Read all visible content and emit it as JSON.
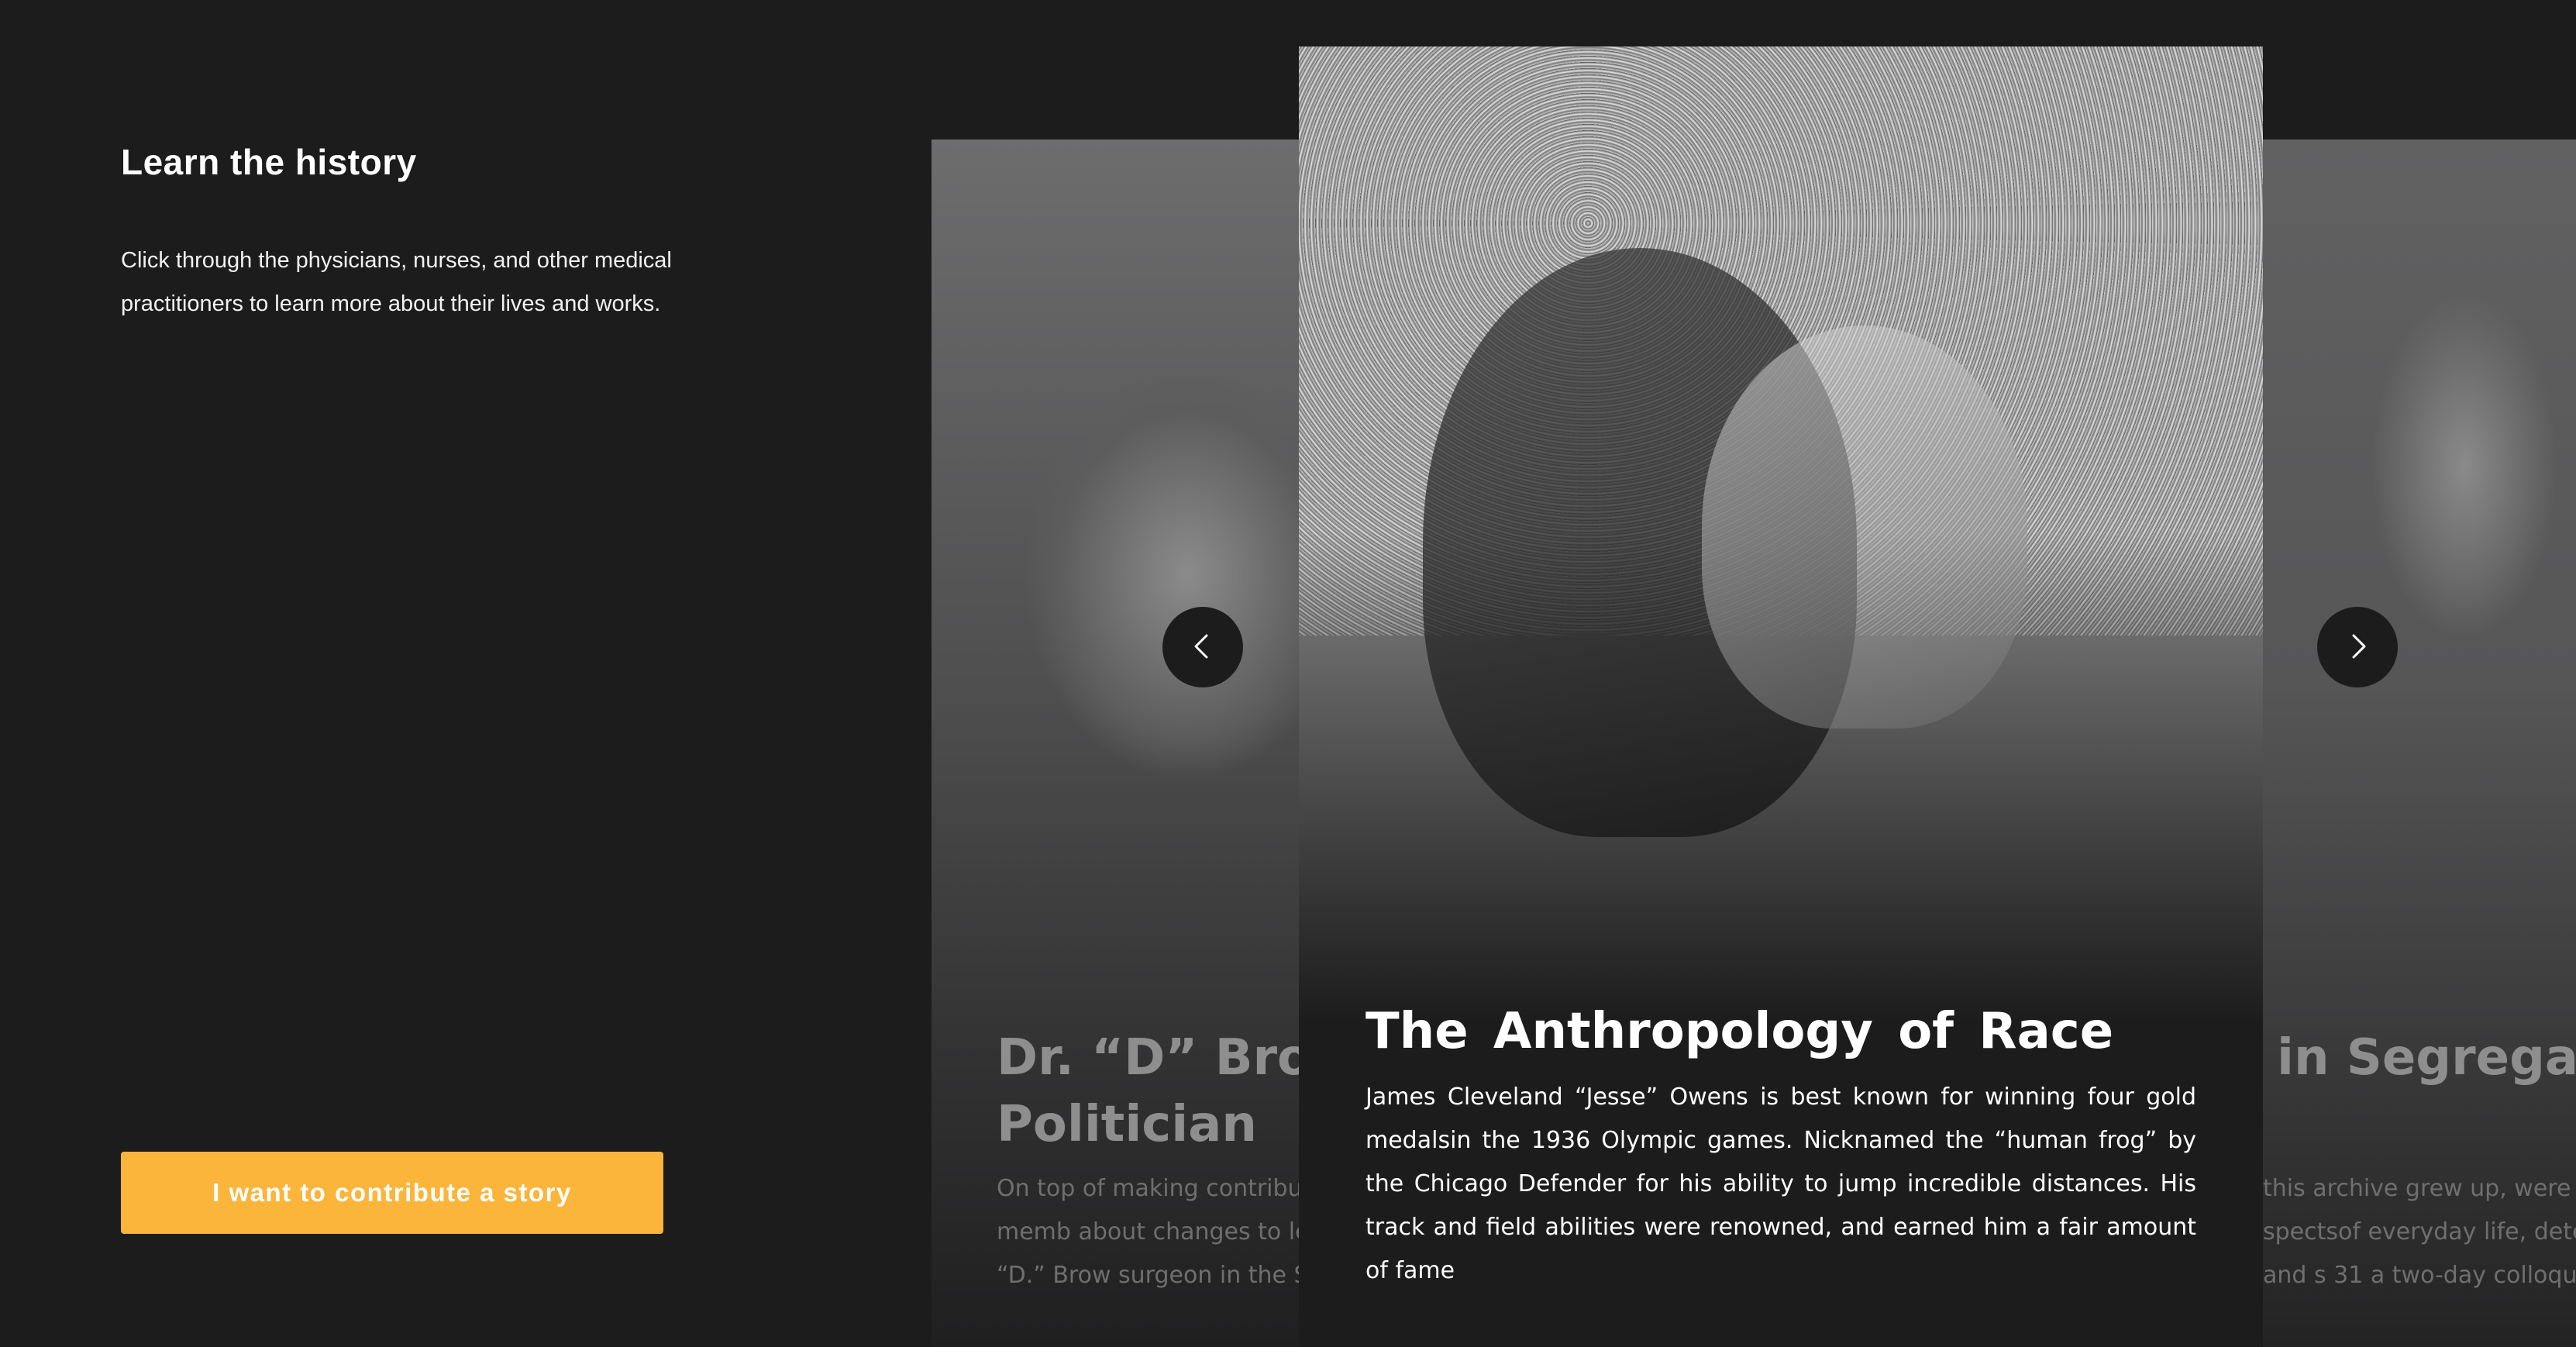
{
  "intro": {
    "title": "Learn the history",
    "text": "Click through the physicians, nurses, and other medical practitioners to learn more about their lives and works."
  },
  "cta": {
    "label": "I want to contribute a story"
  },
  "carousel": {
    "prev_icon": "chevron-left-icon",
    "next_icon": "chevron-right-icon",
    "cards": [
      {
        "title": "Dr. “D” Brow Politician",
        "body": "On top of making contribu and teaching, many memb about changes to legislati Dorothy Lavinia “D.” Brow surgeon in the South, also"
      },
      {
        "title": "The Anthropology of Race",
        "body": "James Cleveland “Jesse” Owens is best known for winning four gold medalsin the 1936 Olympic games. Nicknamed the “human frog” by the Chicago Defender for his ability to jump incredible distances. His track and field abilities were renowned, and earned him a fair amount of fame"
      },
      {
        "title": "in Segregate D.C.",
        "body": "this archive grew up, were e in a society that was se spectsof everyday life, dete theaters, restaurants, and s 31 a two-day colloquium w"
      }
    ]
  },
  "colors": {
    "background": "#1c1c1d",
    "accent": "#fbb53b",
    "text": "#ffffff",
    "muted_text": "#6f6f70"
  }
}
